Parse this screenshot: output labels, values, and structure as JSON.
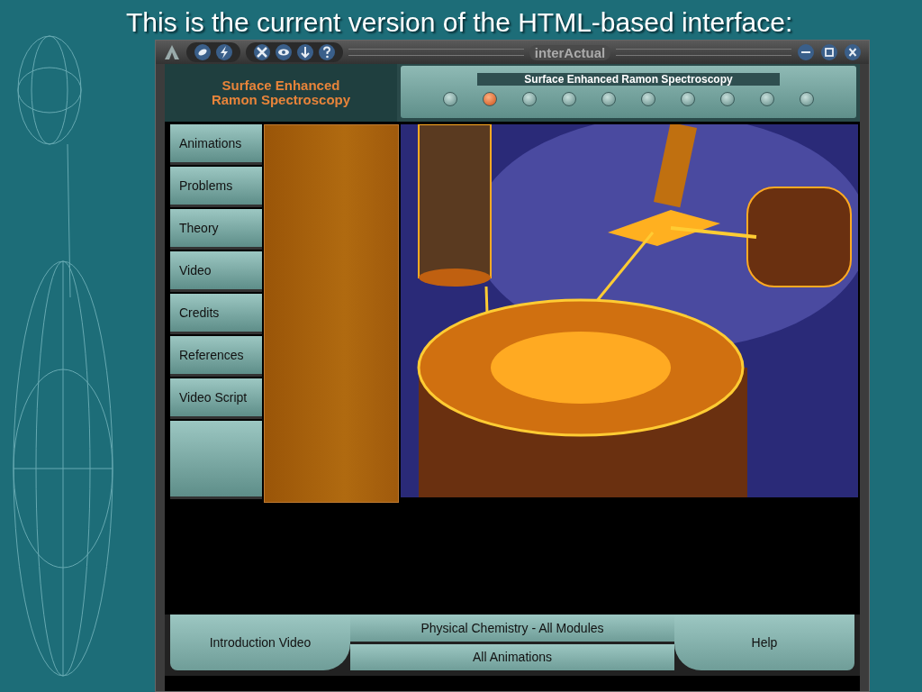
{
  "slide_title": "This is the current version of the HTML-based interface:",
  "window": {
    "title": "interActual"
  },
  "module_title": "Surface Enhanced Ramon Spectroscopy",
  "caption": "Surface Enhanced Ramon Spectroscopy",
  "steps": [
    {
      "selected": false
    },
    {
      "selected": true
    },
    {
      "selected": false
    },
    {
      "selected": false
    },
    {
      "selected": false
    },
    {
      "selected": false
    },
    {
      "selected": false
    },
    {
      "selected": false
    },
    {
      "selected": false
    },
    {
      "selected": false
    }
  ],
  "nav": [
    {
      "label": "Animations"
    },
    {
      "label": "Problems"
    },
    {
      "label": "Theory"
    },
    {
      "label": "Video"
    },
    {
      "label": "Credits"
    },
    {
      "label": "References"
    },
    {
      "label": "Video Script"
    }
  ],
  "bottom_bar": {
    "left": "Introduction Video",
    "center_top": "Physical Chemistry - All Modules",
    "center_bottom": "All Animations",
    "right": "Help"
  }
}
